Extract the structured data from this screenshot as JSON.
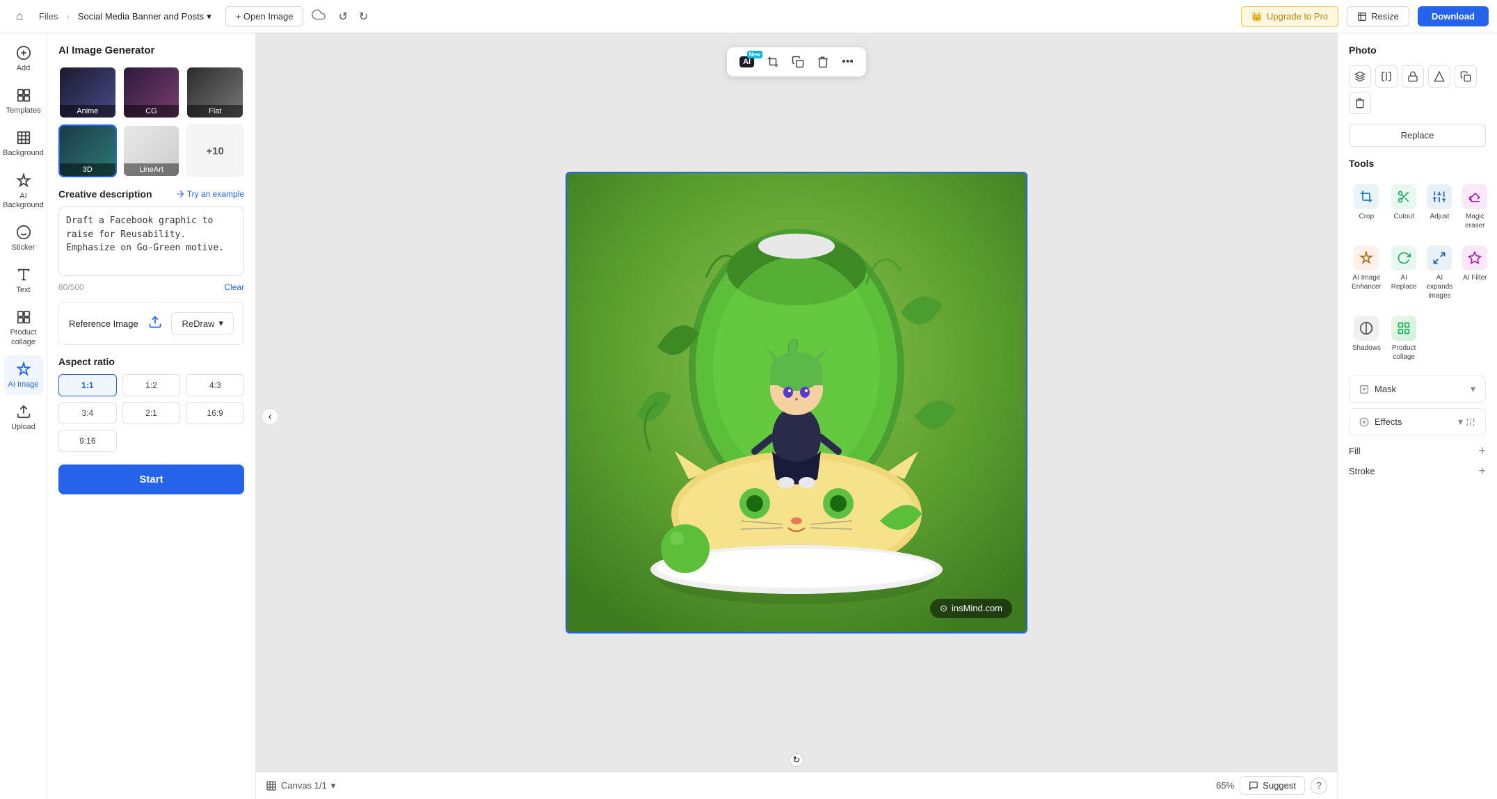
{
  "topbar": {
    "home_icon": "⌂",
    "files_label": "Files",
    "separator": ">",
    "project_name": "Social Media Banner and Posts",
    "chevron_icon": "▾",
    "open_image_label": "+ Open Image",
    "cloud_icon": "☁",
    "undo_icon": "↺",
    "redo_icon": "↻",
    "upgrade_label": "Upgrade to Pro",
    "resize_label": "Resize",
    "download_label": "Download"
  },
  "icon_sidebar": {
    "items": [
      {
        "id": "add",
        "icon": "＋",
        "label": "Add"
      },
      {
        "id": "templates",
        "icon": "⊞",
        "label": "Templates"
      },
      {
        "id": "background",
        "icon": "≋",
        "label": "Background"
      },
      {
        "id": "ai-background",
        "icon": "✦",
        "label": "AI Background"
      },
      {
        "id": "sticker",
        "icon": "☺",
        "label": "Sticker"
      },
      {
        "id": "text",
        "icon": "T",
        "label": "Text"
      },
      {
        "id": "product-collage",
        "icon": "⊡",
        "label": "Product collage"
      },
      {
        "id": "ai-image",
        "icon": "⊛",
        "label": "AI Image"
      },
      {
        "id": "upload",
        "icon": "↑",
        "label": "Upload"
      }
    ]
  },
  "left_panel": {
    "title": "AI Image Generator",
    "styles": [
      {
        "id": "anime",
        "label": "Anime",
        "active": false
      },
      {
        "id": "cg",
        "label": "CG",
        "active": false
      },
      {
        "id": "flat",
        "label": "Flat",
        "active": false
      },
      {
        "id": "3d",
        "label": "3D",
        "active": true
      },
      {
        "id": "lineart",
        "label": "LineArt",
        "active": false
      }
    ],
    "more_label": "+10",
    "creative_desc_title": "Creative description",
    "try_example_label": "Try an example",
    "description_text": "Draft a Facebook graphic to raise for Reusability. Emphasize on Go-Green motive.",
    "char_count": "80/500",
    "clear_label": "Clear",
    "reference_image_title": "Reference Image",
    "redraw_label": "ReDraw",
    "aspect_ratio_title": "Aspect ratio",
    "ratios": [
      {
        "value": "1:1",
        "active": true
      },
      {
        "value": "1:2",
        "active": false
      },
      {
        "value": "4:3",
        "active": false
      },
      {
        "value": "3:4",
        "active": false
      },
      {
        "value": "2:1",
        "active": false
      },
      {
        "value": "16:9",
        "active": false
      },
      {
        "value": "9:16",
        "active": false
      }
    ],
    "start_label": "Start"
  },
  "canvas": {
    "toolbar_items": [
      {
        "id": "ai-tool",
        "icon": "AI",
        "badge": "New"
      },
      {
        "id": "crop-tool",
        "icon": "⊡"
      },
      {
        "id": "copy-tool",
        "icon": "⧉"
      },
      {
        "id": "delete-tool",
        "icon": "🗑"
      },
      {
        "id": "more-tool",
        "icon": "•••"
      }
    ],
    "canvas_label": "Canvas 1/1",
    "zoom_level": "65%",
    "suggest_label": "Suggest",
    "help_icon": "?",
    "watermark": "insMind.com"
  },
  "right_panel": {
    "section_title": "Photo",
    "photo_icons": [
      "⧉",
      "⧋",
      "🔒",
      "⬡",
      "⧉",
      "🗑"
    ],
    "replace_label": "Replace",
    "tools_title": "Tools",
    "tools": [
      {
        "id": "crop",
        "label": "Crop",
        "icon": "⊡",
        "style": "crop"
      },
      {
        "id": "cutout",
        "label": "Cutout",
        "icon": "✂",
        "style": "cutout"
      },
      {
        "id": "adjust",
        "label": "Adjust",
        "icon": "⊞",
        "style": "adjust"
      },
      {
        "id": "magic-eraser",
        "label": "Magic eraser",
        "icon": "✦",
        "style": "eraser"
      },
      {
        "id": "ai-enhancer",
        "label": "AI Image Enhancer",
        "icon": "⬆",
        "style": "enhancer"
      },
      {
        "id": "ai-replace",
        "label": "AI Replace",
        "icon": "↺",
        "style": "replace"
      },
      {
        "id": "ai-expands",
        "label": "AI expands images",
        "icon": "⤢",
        "style": "expand"
      },
      {
        "id": "ai-filter",
        "label": "AI Filter",
        "icon": "◈",
        "style": "filter"
      },
      {
        "id": "shadows",
        "label": "Shadows",
        "icon": "◐",
        "style": "shadows"
      },
      {
        "id": "product-collage",
        "label": "Product collage",
        "icon": "⊞",
        "style": "collage"
      }
    ],
    "mask_label": "Mask",
    "effects_label": "Effects",
    "fill_label": "Fill",
    "stroke_label": "Stroke",
    "add_icon": "+"
  }
}
